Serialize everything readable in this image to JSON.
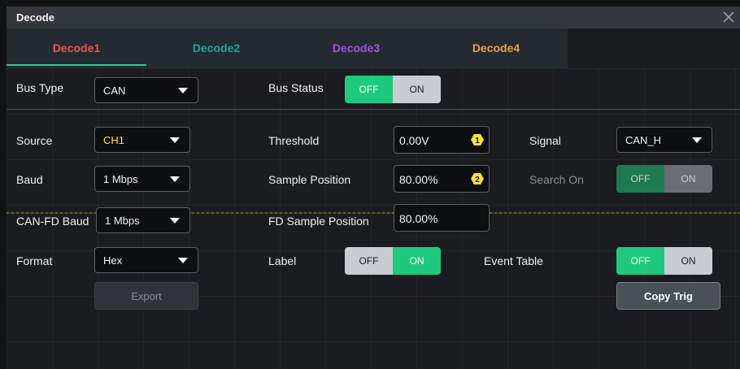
{
  "dialog": {
    "title": "Decode",
    "tabs": [
      {
        "label": "Decode1",
        "color": "#f0564c",
        "active": true
      },
      {
        "label": "Decode2",
        "color": "#1fa3a3",
        "active": false
      },
      {
        "label": "Decode3",
        "color": "#a054e0",
        "active": false
      },
      {
        "label": "Decode4",
        "color": "#f0a04c",
        "active": false
      }
    ]
  },
  "bus_type": {
    "label": "Bus Type",
    "value": "CAN"
  },
  "bus_status": {
    "label": "Bus Status",
    "off": "OFF",
    "on": "ON",
    "selected": "OFF"
  },
  "source": {
    "label": "Source",
    "value": "CH1",
    "value_color": "#f5e23a"
  },
  "threshold": {
    "label": "Threshold",
    "value": "0.00V",
    "knob": "1"
  },
  "signal": {
    "label": "Signal",
    "value": "CAN_H"
  },
  "baud": {
    "label": "Baud",
    "value": "1 Mbps"
  },
  "sample_position": {
    "label": "Sample Position",
    "value": "80.00%",
    "knob": "2"
  },
  "search_on": {
    "label": "Search On",
    "off": "OFF",
    "on": "ON",
    "selected": "OFF",
    "enabled": false
  },
  "canfd_baud": {
    "label": "CAN-FD Baud",
    "value": "1 Mbps"
  },
  "fd_sample_position": {
    "label": "FD Sample Position",
    "value": "80.00%"
  },
  "format": {
    "label": "Format",
    "value": "Hex"
  },
  "label_toggle": {
    "label": "Label",
    "off": "OFF",
    "on": "ON",
    "selected": "ON"
  },
  "event_table": {
    "label": "Event Table",
    "off": "OFF",
    "on": "ON",
    "selected": "OFF"
  },
  "buttons": {
    "export": "Export",
    "copy_trig": "Copy Trig"
  },
  "colors": {
    "accent_green": "#1ec97e",
    "knob_yellow": "#f5e23a"
  }
}
